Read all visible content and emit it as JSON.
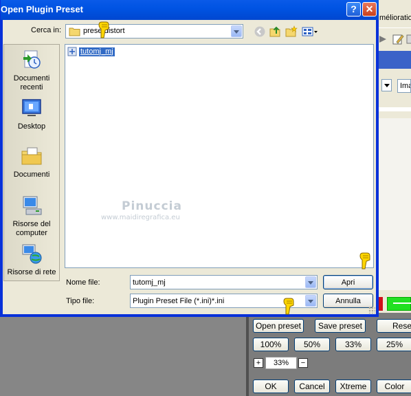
{
  "dialog": {
    "title": "Open Plugin Preset",
    "help_label": "?",
    "close_label": "✕",
    "lookin_label": "Cerca in:",
    "lookin_value": "presetdistort",
    "places": [
      {
        "label": "Documenti recenti"
      },
      {
        "label": "Desktop"
      },
      {
        "label": "Documenti"
      },
      {
        "label": "Risorse del computer"
      },
      {
        "label": "Risorse di rete"
      }
    ],
    "files": [
      {
        "name": "tutomj_mj",
        "selected": true
      }
    ],
    "filename_label": "Nome file:",
    "filename_value": "tutomj_mj",
    "filetype_label": "Tipo file:",
    "filetype_value": "Plugin Preset File (*.ini)*.ini",
    "open_button": "Apri",
    "cancel_button": "Annulla",
    "watermark_name": "Pinuccia",
    "watermark_url": "www.maidiregrafica.eu"
  },
  "background_app": {
    "title_fragment": "mélioration",
    "input_fragment": "Ima",
    "buttons_row1": [
      "Open preset",
      "Save preset",
      "Reset"
    ],
    "zoom_buttons": [
      "100%",
      "50%",
      "33%",
      "25%"
    ],
    "zoom_plus": "+",
    "zoom_value": "33%",
    "zoom_minus": "−",
    "bottom_buttons": [
      "OK",
      "Cancel",
      "Xtreme",
      "Color"
    ]
  },
  "colors": {
    "titlebar": "#0054e3",
    "selection": "#316ac5",
    "dialog_bg": "#ece9d8",
    "bg_gray": "#868686"
  }
}
